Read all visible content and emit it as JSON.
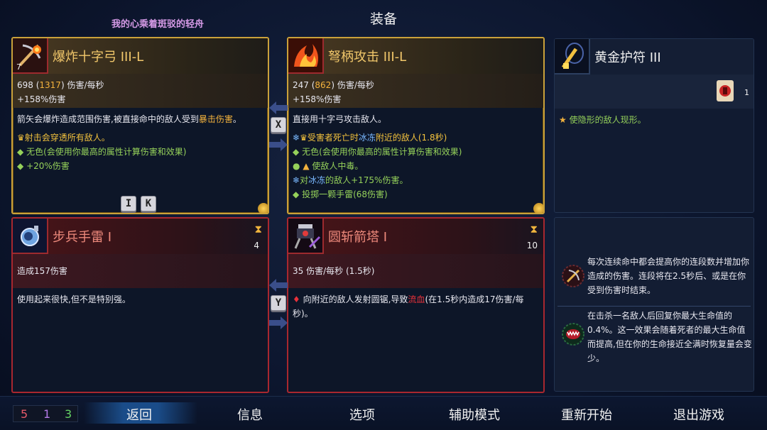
{
  "title": "装备",
  "subtitle": "我的心乘着斑驳的轻舟",
  "cards": {
    "crossbow_main": {
      "name": "爆炸十字弓 III-L",
      "icon": "explosive-crossbow-icon",
      "count": "7",
      "stat_dps": "698",
      "stat_dps_crit": "1317",
      "stat_dps_unit": "伤害/每秒",
      "stat_bonus": "+158%伤害",
      "desc_pre": "箭矢会爆炸造成范围伤害,被直接命中的敌人受到",
      "desc_hl": "暴击伤害",
      "desc_post": "。",
      "affix1": "射击会穿透所有敌人。",
      "affix2": "无色(会使用你最高的属性计算伤害和效果)",
      "affix3": "+20%伤害",
      "key1": "I",
      "key2": "K"
    },
    "crossbow_melee": {
      "name": "弩柄攻击 III-L",
      "icon": "flame-bash-icon",
      "stat_dps": "247",
      "stat_dps_crit": "862",
      "stat_dps_unit": "伤害/每秒",
      "stat_bonus": "+158%伤害",
      "desc": "直接用十字弓攻击敌人。",
      "affix1_pre": "受害者死亡时",
      "affix1_hl": "冰冻",
      "affix1_post": "附近的敌人(1.8秒)",
      "affix2": "无色(会使用你最高的属性计算伤害和效果)",
      "affix3": "使敌人中毒。",
      "affix4_pre": "对",
      "affix4_hl": "冰冻",
      "affix4_post": "的敌人+175%伤害。",
      "affix5": "投掷一颗手雷(68伤害)"
    },
    "amulet": {
      "name": "黄金护符 III",
      "icon": "golden-amulet-icon",
      "scroll_count": "1",
      "affix1": "使隐形的敌人现形。"
    },
    "grenade": {
      "name": "步兵手雷 I",
      "icon": "infantry-grenade-icon",
      "charges": "4",
      "stat": "造成157伤害",
      "desc": "使用起来很快,但不是特别强。"
    },
    "turret": {
      "name": "圆斩箭塔 I",
      "icon": "sawblade-turret-icon",
      "charges": "10",
      "stat": "35 伤害/每秒 (1.5秒)",
      "desc_pre": "向附近的敌人发射圆锯,导致",
      "desc_hl": "流血",
      "desc_post": "(在1.5秒内造成17伤害/每秒)。"
    },
    "mutations": {
      "m1": "每次连续命中都会提高你的连段数并增加你造成的伤害。连段将在2.5秒后、或是在你受到伤害时结束。",
      "m2": "在击杀一名敌人后回复你最大生命值的0.4%。这一效果会随着死者的最大生命值而提高,但在你的生命接近全满时恢复量会变少。"
    }
  },
  "swap_keys": {
    "top": "X",
    "bottom": "Y"
  },
  "footer": {
    "res1": "5",
    "res2": "1",
    "res3": "3",
    "back": "返回",
    "info": "信息",
    "options": "选项",
    "assist": "辅助模式",
    "restart": "重新开始",
    "quit": "退出游戏"
  },
  "colors": {
    "gold": "#caa13a",
    "red": "#a8272f",
    "res_red": "#e85a6a",
    "res_purple": "#b57ae8",
    "res_green": "#64d264"
  }
}
